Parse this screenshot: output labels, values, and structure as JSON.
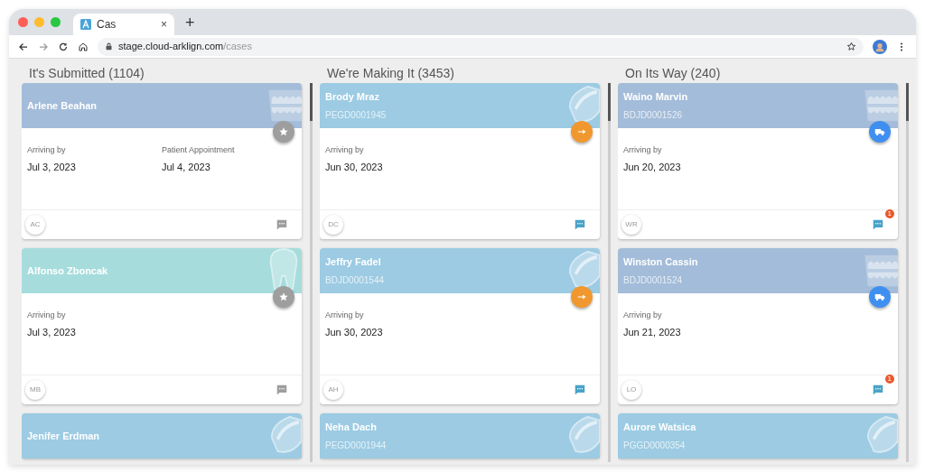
{
  "browser": {
    "tab": {
      "title": "Cas",
      "close": "×"
    },
    "new_tab": "+",
    "address": {
      "host": "stage.cloud-arklign.com",
      "path": "/cases"
    }
  },
  "columns": [
    {
      "title": "It's Submitted (1104)",
      "cards": [
        {
          "name": "Arlene Beahan",
          "color": "#a3bcd9",
          "kind": "teeth",
          "action": {
            "kind": "star"
          },
          "fields": [
            {
              "label": "Arriving by",
              "value": "Jul 3, 2023"
            },
            {
              "label": "Patient Appointment",
              "value": "Jul 4, 2023"
            }
          ],
          "initials": "AC",
          "chat_active": false
        },
        {
          "name": "Alfonso Zboncak",
          "color": "#a6dcdc",
          "kind": "tooth",
          "action": {
            "kind": "star"
          },
          "fields": [
            {
              "label": "Arriving by",
              "value": "Jul 3, 2023"
            }
          ],
          "initials": "MB",
          "chat_active": false
        },
        {
          "name": "Jenifer Erdman",
          "color": "#9ccbe3",
          "kind": "tray"
        }
      ]
    },
    {
      "title": "We're Making It (3453)",
      "cards": [
        {
          "name": "Brody Mraz",
          "code": "PEGD0001945",
          "color": "#9ccbe3",
          "kind": "tray",
          "action": {
            "kind": "arrow"
          },
          "fields": [
            {
              "label": "Arriving by",
              "value": "Jun 30, 2023"
            }
          ],
          "initials": "DC",
          "chat_active": true
        },
        {
          "name": "Jeffry Fadel",
          "code": "BDJD0001544",
          "color": "#9ccbe3",
          "kind": "tray",
          "action": {
            "kind": "arrow"
          },
          "fields": [
            {
              "label": "Arriving by",
              "value": "Jun 30, 2023"
            }
          ],
          "initials": "AH",
          "chat_active": true
        },
        {
          "name": "Neha Dach",
          "code": "PEGD0001944",
          "color": "#9ccbe3",
          "kind": "tray"
        }
      ]
    },
    {
      "title": "On Its Way (240)",
      "cards": [
        {
          "name": "Waino Marvin",
          "code": "BDJD0001526",
          "color": "#a3bcd9",
          "kind": "teeth",
          "action": {
            "kind": "truck"
          },
          "fields": [
            {
              "label": "Arriving by",
              "value": "Jun 20, 2023"
            }
          ],
          "initials": "WR",
          "chat_active": true,
          "badge": "1"
        },
        {
          "name": "Winston Cassin",
          "code": "BDJD0001524",
          "color": "#a3bcd9",
          "kind": "teeth",
          "action": {
            "kind": "truck"
          },
          "fields": [
            {
              "label": "Arriving by",
              "value": "Jun 21, 2023"
            }
          ],
          "initials": "LO",
          "chat_active": true,
          "badge": "1"
        },
        {
          "name": "Aurore Watsica",
          "code": "PGGD0000354",
          "color": "#9ccbe3",
          "kind": "tray"
        }
      ]
    }
  ]
}
